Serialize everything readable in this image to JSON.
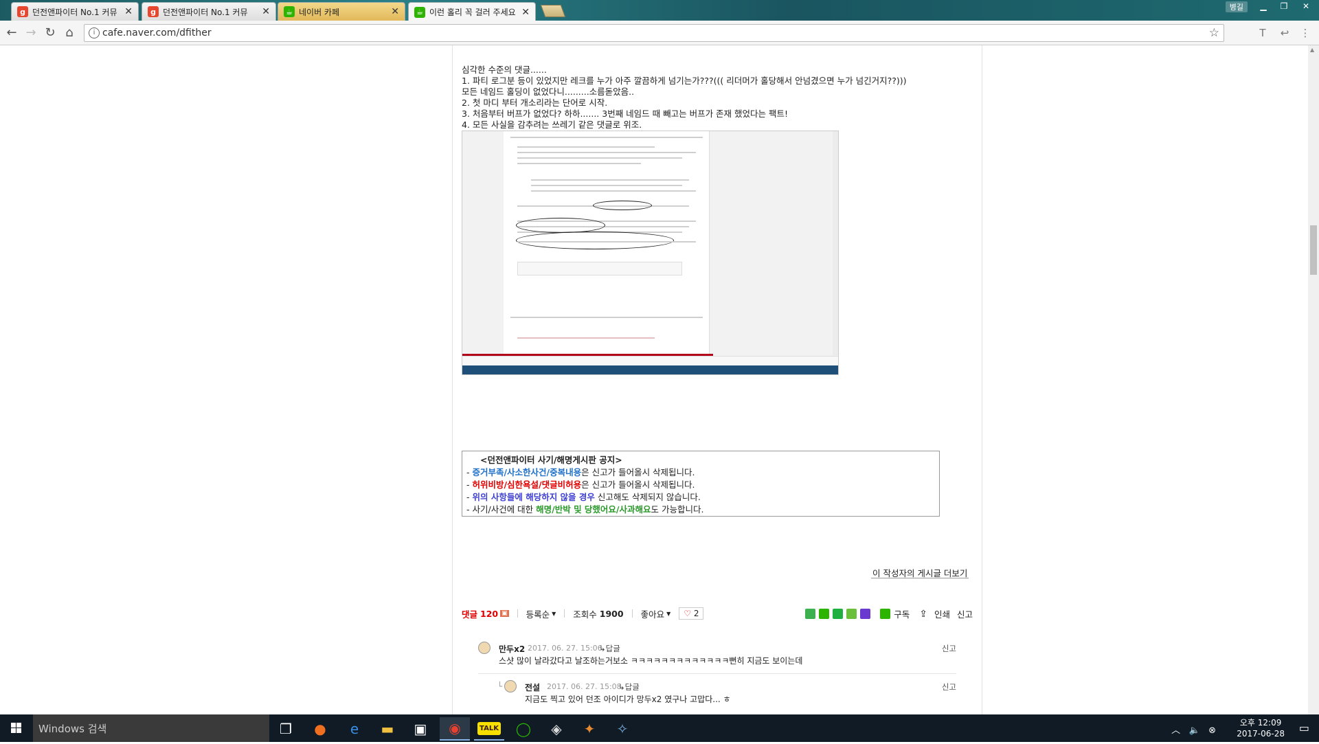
{
  "browser": {
    "tabs": [
      {
        "title": "던전앤파이터 No.1 커뮤",
        "icon": "g",
        "color": "#e8472f"
      },
      {
        "title": "던전앤파이터 No.1 커뮤",
        "icon": "g",
        "color": "#e8472f"
      },
      {
        "title": "네이버 카페",
        "icon": "☕",
        "color": "#2db400"
      },
      {
        "title": "이런 홀리 꼭 걸러 주세요",
        "icon": "☕",
        "color": "#2db400"
      }
    ],
    "user_label": "병길",
    "url": "cafe.naver.com/dfither"
  },
  "article": {
    "lines": [
      "심각한 수준의 댓글......",
      "1. 파티 로그분 등이 있었지만 레크를 누가 아주 깔끔하게 넘기는가???((( 리더머가 홀당해서 안넘겼으면 누가 넘긴거지??)))",
      "모든 네임드 홀딩이 없었다니.........소름돋았음..",
      "2. 첫 마디 부터 개소리라는 단어로 시작.",
      "3. 처음부터 버프가 없었다? 하하....... 3번째 네임드 때 빼고는 버프가 존재 했었다는 팩트!",
      "4. 모든 사실을 감추려는 쓰레기 같은 댓글로 위조."
    ]
  },
  "notice": {
    "title": "<던전앤파이터 사기/해명게시판 공지>",
    "rows": [
      {
        "dash": "- ",
        "hl": "증거부족/사소한사건/중복내용",
        "rest": "은 신고가 들어올시 삭제됩니다."
      },
      {
        "dash": "- ",
        "hl": "허위비방/심한욕설/댓글비허용",
        "rest": "은 신고가 들어올시 삭제됩니다."
      },
      {
        "dash": "- ",
        "hl": "위의 사항들에 해당하지 않을 경우",
        "rest": " 신고해도 삭제되지 않습니다."
      },
      {
        "dash": "- ",
        "pre": "사기/사건에 대한 ",
        "hl": "해명/반박 및 당했어요/사과해요",
        "rest": "도 가능합니다."
      }
    ]
  },
  "more_posts": "이 작성자의 게시글 더보기",
  "comment_bar": {
    "comment_label": "댓글",
    "comment_count": "120",
    "sort": "등록순",
    "views_label": "조회수",
    "views": "1900",
    "like_label": "좋아요",
    "like_count": "2",
    "subscribe": "구독",
    "print": "인쇄",
    "report": "신고"
  },
  "comments": [
    {
      "nick": "만두x2",
      "date": "2017. 06. 27. 15:06",
      "reply": "답글",
      "text": "스샷 많이 날라갔다고 날조하는거보소 ㅋㅋㅋㅋㅋㅋㅋㅋㅋㅋㅋㅋㅋ뻔히 지금도 보이는데",
      "report": "신고"
    },
    {
      "nick": "전설",
      "date": "2017. 06. 27. 15:08",
      "reply": "답글",
      "text": "지금도 찍고 있어 던조 아이디가 망두x2 였구나 고맙다... ㅎ",
      "report": "신고"
    }
  ],
  "taskbar": {
    "search_placeholder": "Windows 검색",
    "time": "오후 12:09",
    "date": "2017-06-28"
  }
}
